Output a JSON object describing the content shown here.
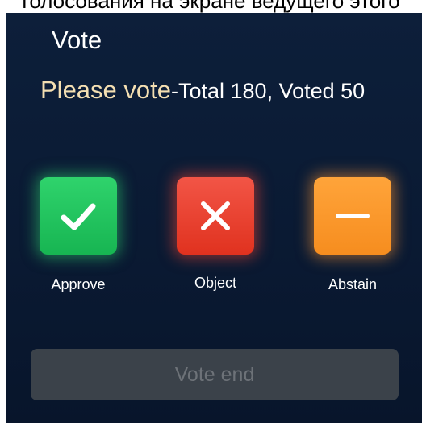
{
  "caption": "голосования на экране ведущего этого",
  "panel": {
    "title": "Vote",
    "prompt": {
      "label": "Please vote",
      "stats": "-Total 180, Voted 50"
    },
    "options": [
      {
        "label": "Approve",
        "icon": "check-icon",
        "color": "#22c55e"
      },
      {
        "label": "Object",
        "icon": "close-icon",
        "color": "#ea4230"
      },
      {
        "label": "Abstain",
        "icon": "minus-icon",
        "color": "#fb9a2b"
      }
    ],
    "end_button": {
      "label": "Vote end",
      "state": "disabled"
    }
  }
}
